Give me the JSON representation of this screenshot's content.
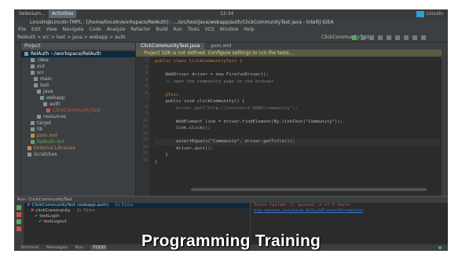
{
  "colors": {
    "ide_bg": "#2b2b2b",
    "panel_bg": "#3c3f41",
    "error": "#c75450",
    "success": "#59a869",
    "caption": "#ffffff"
  },
  "system_bar": {
    "app_label": "Selenium...",
    "workspace": "Activities",
    "clock": "12:34",
    "user": "Lincoln"
  },
  "title": "Lincoln@Lincoln-TMPL : [/home/lincoln/workspace/RelAuth] - .../src/test/java/webapp/auth/ClickCommunityTest.java - IntelliJ IDEA",
  "menu": [
    "File",
    "Edit",
    "View",
    "Navigate",
    "Code",
    "Analyze",
    "Refactor",
    "Build",
    "Run",
    "Tools",
    "VCS",
    "Window",
    "Help"
  ],
  "navbar": {
    "crumb": "RelAuth > src > test > java > webapp > auth",
    "run_config": "ClickCommunityTest"
  },
  "project_panel": {
    "header": "Project",
    "items": [
      {
        "label": "RelAuth ~/workspace/RelAuth",
        "state": "sel"
      },
      {
        "label": ".idea",
        "state": ""
      },
      {
        "label": "out",
        "state": ""
      },
      {
        "label": "src",
        "state": ""
      },
      {
        "label": "main",
        "state": ""
      },
      {
        "label": "test",
        "state": ""
      },
      {
        "label": "java",
        "state": ""
      },
      {
        "label": "webapp",
        "state": ""
      },
      {
        "label": "auth",
        "state": ""
      },
      {
        "label": "ClickCommunityTest",
        "state": "err"
      },
      {
        "label": "resources",
        "state": ""
      },
      {
        "label": "target",
        "state": ""
      },
      {
        "label": "lib",
        "state": ""
      },
      {
        "label": "pom.xml",
        "state": "orn"
      },
      {
        "label": "RelAuth.iml",
        "state": "grn"
      },
      {
        "label": "External Libraries",
        "state": "orn"
      },
      {
        "label": "Scratches",
        "state": ""
      }
    ]
  },
  "editor": {
    "tabs": [
      "ClickCommunityTest.java",
      "pom.xml"
    ],
    "notice": "Project SDK is not defined. Configure settings to run the tests...",
    "lines": [
      {
        "text": "public class ClickCommunityTest {",
        "cls": "kw"
      },
      {
        "text": "",
        "cls": ""
      },
      {
        "text": "    WebDriver driver = new FirefoxDriver();",
        "cls": ""
      },
      {
        "text": "    // open the community page in the browser",
        "cls": "cm"
      },
      {
        "text": "",
        "cls": ""
      },
      {
        "text": "    @Test",
        "cls": "kw"
      },
      {
        "text": "    public void clickCommunity() {",
        "cls": ""
      },
      {
        "text": "        driver.get(\"http://localhost:8080/community\");",
        "cls": "str"
      },
      {
        "text": "",
        "cls": ""
      },
      {
        "text": "        WebElement link = driver.findElement(By.linkText(\"Community\"));",
        "cls": ""
      },
      {
        "text": "        link.click();",
        "cls": ""
      },
      {
        "text": "",
        "cls": ""
      },
      {
        "text": "        assertEquals(\"Community\", driver.getTitle());",
        "cls": "hl"
      },
      {
        "text": "        driver.quit();",
        "cls": ""
      },
      {
        "text": "    }",
        "cls": ""
      },
      {
        "text": "}",
        "cls": ""
      }
    ]
  },
  "run_panel": {
    "header": "Run:  ClickCommunityTest",
    "results": [
      {
        "label": "ClickCommunityTest (webapp.auth)",
        "state": "bad",
        "time": "2s 31ms"
      },
      {
        "label": "clickCommunity",
        "state": "bad",
        "time": "2s 31ms"
      },
      {
        "label": "testLogin",
        "state": "ok",
        "time": ""
      },
      {
        "label": "testLogout",
        "state": "ok",
        "time": ""
      }
    ],
    "console": [
      {
        "text": "Tests failed: 1, passed: 2 of 3 tests",
        "link": false
      },
      {
        "text": "org.openqa.selenium.NoSuchElementException",
        "link": true
      },
      {
        "text": "",
        "link": false
      }
    ]
  },
  "status_bar": [
    "Terminal",
    "Messages",
    "Run",
    "TODO"
  ],
  "caption": "Programming Training"
}
